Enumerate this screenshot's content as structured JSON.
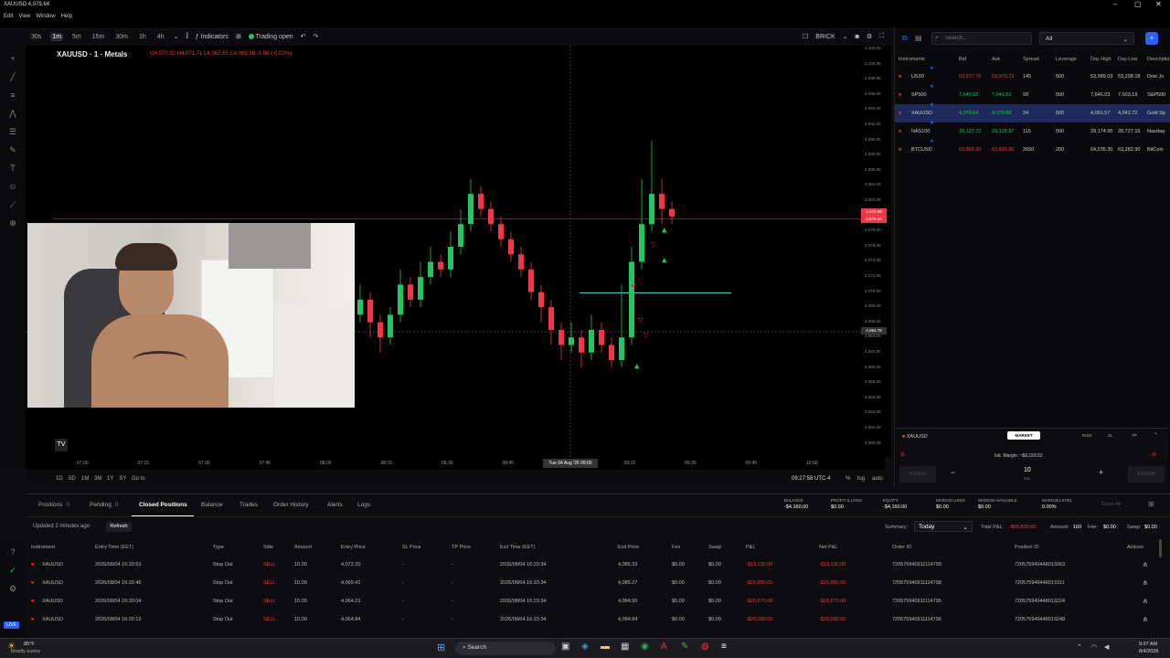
{
  "window": {
    "title": "XAUUSD 4,079.64"
  },
  "menu": [
    "Edit",
    "View",
    "Window",
    "Help"
  ],
  "toolbar": {
    "intervals": [
      "30s",
      "1m",
      "5m",
      "15m",
      "30m",
      "1h",
      "4h"
    ],
    "active_interval": "1m",
    "indicators_label": "Indicators",
    "trading_status": "Trading open",
    "brick_label": "BRICK"
  },
  "chart": {
    "symbol_title": "XAUUSD · 1 · Metals",
    "ohlc": "O4,070.92 H4,071.71 L4,067.65 C4,069.96 -0.96 (-0.02%)",
    "y_ticks": [
      "4,102.00",
      "4,100.00",
      "4,098.00",
      "4,096.00",
      "4,094.00",
      "4,092.00",
      "4,090.00",
      "4,088.00",
      "4,086.00",
      "4,084.00",
      "4,082.00",
      "4,080.00",
      "4,078.00",
      "4,076.00",
      "4,074.00",
      "4,072.00",
      "4,070.00",
      "4,068.00",
      "4,066.00",
      "4,064.00",
      "4,062.00",
      "4,060.00",
      "4,058.00",
      "4,056.00",
      "4,054.00",
      "4,052.00",
      "4,050.00"
    ],
    "x_ticks": [
      "07:00",
      "07:15",
      "07:30",
      "07:45",
      "08:00",
      "08:15",
      "08:30",
      "08:45",
      "09:00",
      "09:15",
      "09:30",
      "09:45",
      "10:00"
    ],
    "crosshair_time": "Tue 04 Aug '26",
    "price_label_top": "4,079.88",
    "price_label_bottom": "4,079.64",
    "crosshair_price": "4,064.75",
    "range_buttons": [
      "1D",
      "5D",
      "1M",
      "3M",
      "1Y",
      "5Y",
      "Go to"
    ],
    "clock": "09:27:58 UTC-4",
    "percent_label": "%",
    "log_label": "log",
    "auto_label": "auto"
  },
  "watchlist": {
    "search_placeholder": "Search...",
    "filter": "All",
    "columns": [
      "Instruments",
      "Bid",
      "Ask",
      "Spread",
      "Leverage",
      "Day High",
      "Day Low",
      "Description"
    ],
    "rows": [
      {
        "symbol": "US30",
        "bid": "53,977.76",
        "ask": "53,979.23",
        "spread": "145",
        "leverage": "500",
        "high": "53,989.03",
        "low": "53,208.18",
        "desc": "Dow Jo",
        "bid_color": "#f23645",
        "ask_color": "#f23645"
      },
      {
        "symbol": "SP500",
        "bid": "7,640.52",
        "ask": "7,641.51",
        "spread": "99",
        "leverage": "500",
        "high": "7,646.03",
        "low": "7,603.19",
        "desc": "S&P500",
        "bid_color": "#22c55e",
        "ask_color": "#22c55e"
      },
      {
        "symbol": "XAUUSD",
        "bid": "4,079.64",
        "ask": "4,079.88",
        "spread": "24",
        "leverage": "500",
        "high": "4,091.57",
        "low": "4,042.72",
        "desc": "Gold Sp",
        "bid_color": "#22c55e",
        "ask_color": "#22c55e"
      },
      {
        "symbol": "NAS100",
        "bid": "29,127.72",
        "ask": "29,128.87",
        "spread": "115",
        "leverage": "500",
        "high": "29,174.95",
        "low": "28,727.16",
        "desc": "Nasdaq",
        "bid_color": "#22c55e",
        "ask_color": "#22c55e"
      },
      {
        "symbol": "BTCUSD",
        "bid": "63,865.30",
        "ask": "63,891.80",
        "spread": "2650",
        "leverage": "200",
        "high": "64,235.30",
        "low": "63,282.90",
        "desc": "BitCoin",
        "bid_color": "#f23645",
        "ask_color": "#f23645"
      }
    ]
  },
  "order": {
    "symbol": "XAUUSD",
    "mode": "MARKET",
    "modes": [
      "RISK",
      "SL",
      "TP"
    ],
    "margin": "Init. Margin: ~$8,159.52",
    "sell_price": "4,079.64",
    "buy_price": "4,079.88",
    "lots": "10",
    "lots_label": "lots"
  },
  "positions": {
    "tabs": [
      {
        "label": "Positions",
        "count": "0"
      },
      {
        "label": "Pending",
        "count": "0"
      },
      {
        "label": "Closed Positions",
        "count": ""
      },
      {
        "label": "Balance",
        "count": ""
      },
      {
        "label": "Trades",
        "count": ""
      },
      {
        "label": "Order History",
        "count": ""
      },
      {
        "label": "Alerts",
        "count": ""
      },
      {
        "label": "Logs",
        "count": ""
      }
    ],
    "stats": [
      {
        "label": "BALANCE",
        "value": "-$4,160.00"
      },
      {
        "label": "PROFIT & LOSS",
        "value": "$0.00"
      },
      {
        "label": "EQUITY",
        "value": "-$4,160.00"
      },
      {
        "label": "MARGIN USED",
        "value": "$0.00"
      },
      {
        "label": "MARGIN AVAILABLE",
        "value": "$0.00"
      },
      {
        "label": "MARGIN LEVEL",
        "value": "0.00%"
      }
    ],
    "close_all": "Close All",
    "updated": "Updated 2 minutes ago",
    "refresh": "Refresh",
    "summary_label": "Summary:",
    "summary_value": "Today",
    "total_pl_label": "Total P&L:",
    "total_pl": "-$65,820.00",
    "amount_label": "Amount:",
    "amount": "160",
    "fee_label": "Fee:",
    "fee": "$0.00",
    "swap_label": "Swap:",
    "swap": "$0.00",
    "columns": [
      "Instrument",
      "Entry Time (EET)",
      "Type",
      "Side",
      "Amount",
      "Entry Price",
      "SL Price",
      "TP Price",
      "Exit Time (EET)",
      "Exit Price",
      "Fee",
      "Swap",
      "P&L",
      "Net P&L",
      "Order ID",
      "Position ID",
      "Actions"
    ],
    "rows": [
      [
        "XAUUSD",
        "2026/08/04 16:20:53",
        "Stop Out",
        "SELL",
        "10.00",
        "4,072.20",
        "-",
        "-",
        "2026/08/04 16:23:34",
        "4,085.33",
        "$0.00",
        "$0.00",
        "-$13,130.00",
        "-$13,130.00",
        "720575940911114799",
        "720575940448013363"
      ],
      [
        "XAUUSD",
        "2026/08/04 16:20:45",
        "Stop Out",
        "SELL",
        "10.00",
        "4,069.42",
        "-",
        "-",
        "2026/08/04 16:23:34",
        "4,085.27",
        "$0.00",
        "$0.00",
        "-$15,850.00",
        "-$15,850.00",
        "720575940911114798",
        "720575940448013311"
      ],
      [
        "XAUUSD",
        "2026/08/04 16:20:04",
        "Stop Out",
        "SELL",
        "10.00",
        "4,064.23",
        "-",
        "-",
        "2026/08/04 16:23:34",
        "4,084.90",
        "$0.00",
        "$0.00",
        "-$20,670.00",
        "-$20,670.00",
        "720575940911114795",
        "720575940448013224"
      ],
      [
        "XAUUSD",
        "2026/08/04 16:20:13",
        "Stop Out",
        "SELL",
        "10.00",
        "4,064.84",
        "-",
        "-",
        "2026/08/04 16:23:34",
        "4,084.84",
        "$0.00",
        "$0.00",
        "-$20,000.00",
        "-$20,000.00",
        "720575940911114796",
        "720575940448013248"
      ]
    ]
  },
  "taskbar": {
    "weather_temp": "85°F",
    "weather_desc": "Mostly sunny",
    "search": "Search",
    "time": "9:27 AM",
    "date": "8/4/2026"
  },
  "live_badge": "LIVE",
  "candles": [
    [
      4067,
      4069,
      4071,
      4066
    ],
    [
      4069,
      4066,
      4070,
      4064
    ],
    [
      4066,
      4064,
      4067,
      4062
    ],
    [
      4064,
      4067,
      4068,
      4063
    ],
    [
      4067,
      4071,
      4073,
      4066
    ],
    [
      4071,
      4069,
      4072,
      4068
    ],
    [
      4069,
      4072,
      4074,
      4068
    ],
    [
      4072,
      4074,
      4076,
      4071
    ],
    [
      4074,
      4073,
      4075,
      4072
    ],
    [
      4073,
      4076,
      4078,
      4072
    ],
    [
      4076,
      4079,
      4081,
      4075
    ],
    [
      4079,
      4083,
      4085,
      4078
    ],
    [
      4083,
      4081,
      4084,
      4080
    ],
    [
      4081,
      4079,
      4082,
      4078
    ],
    [
      4079,
      4077,
      4080,
      4076
    ],
    [
      4077,
      4075,
      4078,
      4074
    ],
    [
      4075,
      4073,
      4076,
      4072
    ],
    [
      4073,
      4070,
      4074,
      4069
    ],
    [
      4070,
      4068,
      4071,
      4066
    ],
    [
      4068,
      4065,
      4069,
      4063
    ],
    [
      4065,
      4063,
      4066,
      4061
    ],
    [
      4063,
      4064,
      4066,
      4062
    ],
    [
      4064,
      4062,
      4065,
      4060
    ],
    [
      4062,
      4065,
      4067,
      4061
    ],
    [
      4065,
      4063,
      4066,
      4062
    ],
    [
      4063,
      4061,
      4064,
      4060
    ],
    [
      4061,
      4064,
      4071,
      4060
    ],
    [
      4064,
      4074,
      4076,
      4063
    ],
    [
      4074,
      4079,
      4085,
      4073
    ],
    [
      4079,
      4083,
      4090,
      4078
    ],
    [
      4083,
      4081,
      4085,
      4079
    ],
    [
      4081,
      4080,
      4082,
      4079
    ]
  ]
}
